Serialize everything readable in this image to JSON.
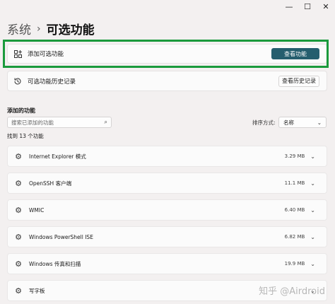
{
  "window": {
    "minimize": "—",
    "maximize": "☐",
    "close": "✕"
  },
  "breadcrumb": {
    "parent": "系统",
    "separator": "›",
    "current": "可选功能"
  },
  "add_feature": {
    "label": "添加可选功能",
    "button": "查看功能"
  },
  "history": {
    "label": "可选功能历史记录",
    "button": "查看历史记录"
  },
  "installed": {
    "title": "添加的功能",
    "search_placeholder": "搜索已添加的功能",
    "sort_label": "排序方式:",
    "sort_value": "名称",
    "found": "找到 13 个功能"
  },
  "features": [
    {
      "name": "Internet Explorer 模式",
      "size": "3.29 MB"
    },
    {
      "name": "OpenSSH 客户端",
      "size": "11.1 MB"
    },
    {
      "name": "WMIC",
      "size": "6.40 MB"
    },
    {
      "name": "Windows PowerShell ISE",
      "size": "6.82 MB"
    },
    {
      "name": "Windows 传真和扫描",
      "size": "19.9 MB"
    },
    {
      "name": "写字板",
      "size": ""
    }
  ],
  "watermark": "知乎 @Airdroid",
  "colors": {
    "primary_button": "#255e6e",
    "highlight_border": "#1a9a3c"
  }
}
